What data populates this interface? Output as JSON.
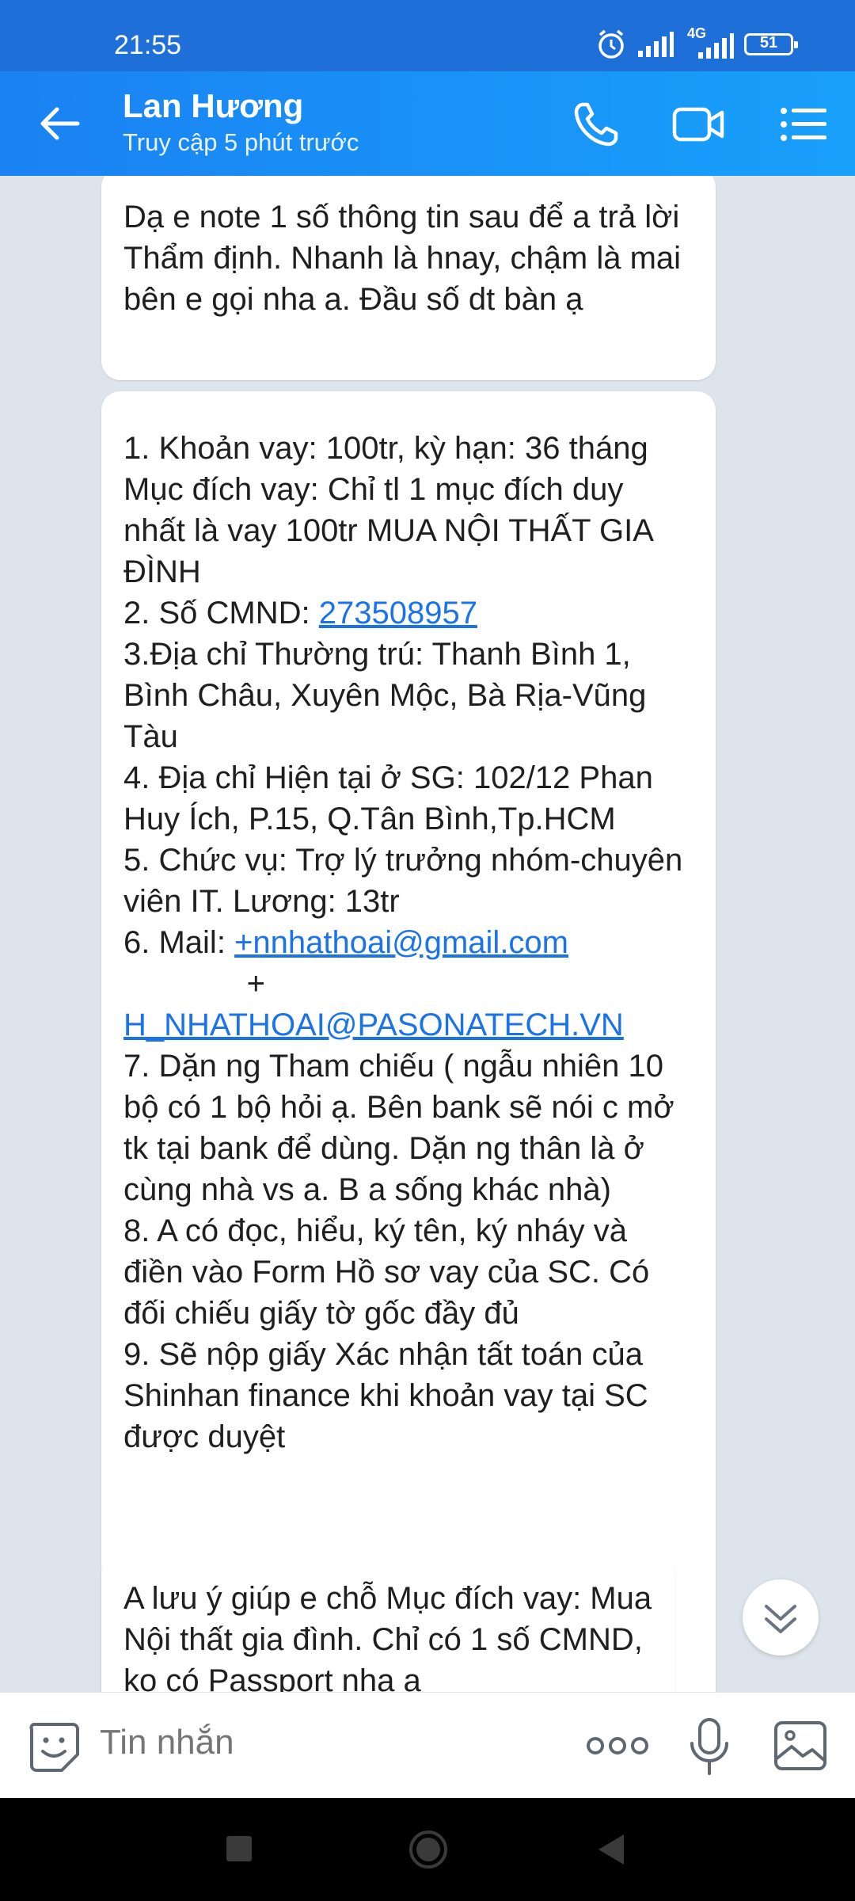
{
  "status": {
    "time": "21:55",
    "network": "4G",
    "battery": "51"
  },
  "header": {
    "name": "Lan Hương",
    "subtitle": "Truy cập 5 phút trước"
  },
  "messages": {
    "m1": "Dạ e note 1 số thông tin sau để a trả lời Thẩm định. Nhanh là hnay, chậm là mai bên e gọi nha a. Đầu số dt bàn ạ",
    "m2": {
      "before_id": "1. Khoản vay: 100tr, kỳ hạn: 36 tháng\nMục đích vay: Chỉ tl 1 mục đích duy nhất là vay 100tr MUA NỘI THẤT GIA ĐÌNH\n2. Số CMND: ",
      "id_number": "273508957",
      "middle": "\n3.Địa chỉ Thường trú: Thanh Bình 1, Bình Châu, Xuyên Mộc, Bà Rịa-Vũng Tàu\n4. Địa chỉ Hiện tại ở SG: 102/12 Phan Huy Ích, P.15, Q.Tân Bình,Tp.HCM\n5. Chức vụ: Trợ lý trưởng nhóm-chuyên viên IT. Lương: 13tr\n6. Mail: ",
      "email1": "+nnhathoai@gmail.com",
      "plus": "\n              +\n",
      "email2": "H_NHATHOAI@PASONATECH.VN",
      "after": "\n7. Dặn ng Tham chiếu ( ngẫu nhiên 10 bộ có 1 bộ hỏi ạ. Bên bank sẽ nói c mở tk tại bank để dùng. Dặn ng thân là ở cùng nhà vs a. B a sống khác nhà)\n8. A có đọc, hiểu, ký tên, ký nháy và điền vào Form Hồ sơ vay của SC. Có đối chiếu giấy tờ gốc đầy đủ\n9. Sẽ nộp giấy Xác nhận tất toán của Shinhan finance khi khoản vay tại SC được duyệt"
    },
    "m3": "A lưu ý giúp e chỗ Mục đích vay: Mua Nội thất gia đình. Chỉ có 1 số CMND, ko có Passport nha a"
  },
  "input": {
    "placeholder": "Tin nhắn"
  },
  "icons": {
    "back": "arrow-left-icon",
    "call": "phone-icon",
    "video": "video-camera-icon",
    "menu": "list-menu-icon",
    "sticker": "sticker-smile-icon",
    "more": "more-dots-icon",
    "mic": "microphone-icon",
    "image": "image-icon",
    "scroll": "chevron-double-down-icon"
  },
  "colors": {
    "header": "#1a82f2",
    "link": "#1a73e8",
    "chat_bg": "#dde4ec"
  }
}
